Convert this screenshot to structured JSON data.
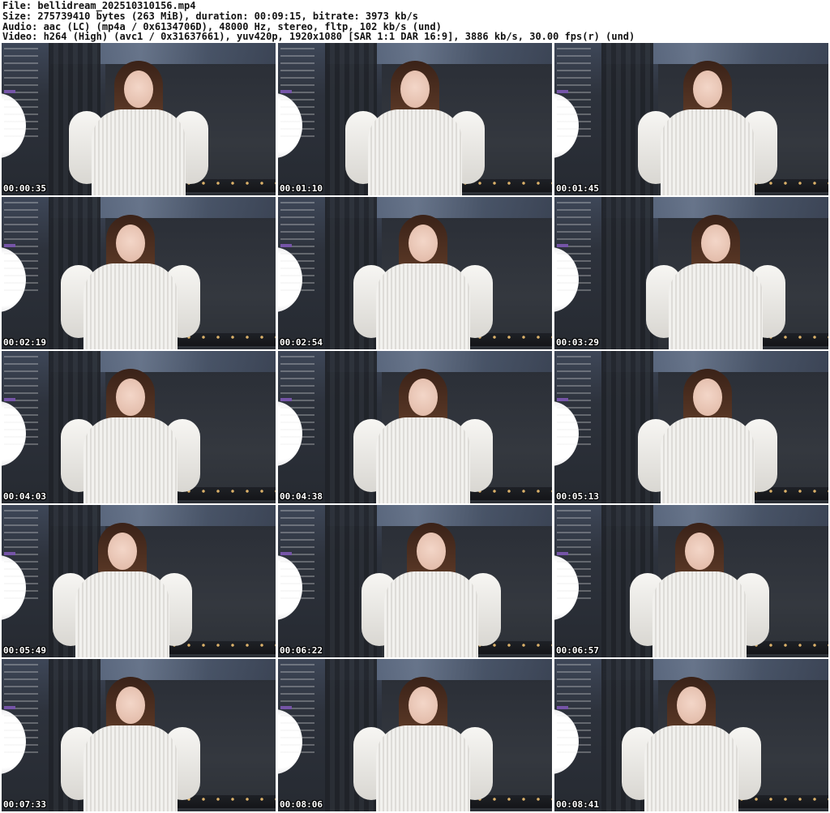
{
  "header": {
    "file": "File: bellidream_202510310156.mp4",
    "size": "Size: 275739410 bytes (263 MiB), duration: 00:09:15, bitrate: 3973 kb/s",
    "audio": "Audio: aac (LC) (mp4a / 0x6134706D), 48000 Hz, stereo, fltp, 102 kb/s (und)",
    "video": "Video: h264 (High) (avc1 / 0x31637661), yuv420p, 1920x1080 [SAR 1:1 DAR 16:9], 3886 kb/s, 30.00 fps(r) (und)"
  },
  "thumbnails": [
    {
      "time": "00:00:35"
    },
    {
      "time": "00:01:10"
    },
    {
      "time": "00:01:45"
    },
    {
      "time": "00:02:19"
    },
    {
      "time": "00:02:54"
    },
    {
      "time": "00:03:29"
    },
    {
      "time": "00:04:03"
    },
    {
      "time": "00:04:38"
    },
    {
      "time": "00:05:13"
    },
    {
      "time": "00:05:49"
    },
    {
      "time": "00:06:22"
    },
    {
      "time": "00:06:57"
    },
    {
      "time": "00:07:33"
    },
    {
      "time": "00:08:06"
    },
    {
      "time": "00:08:41"
    }
  ]
}
